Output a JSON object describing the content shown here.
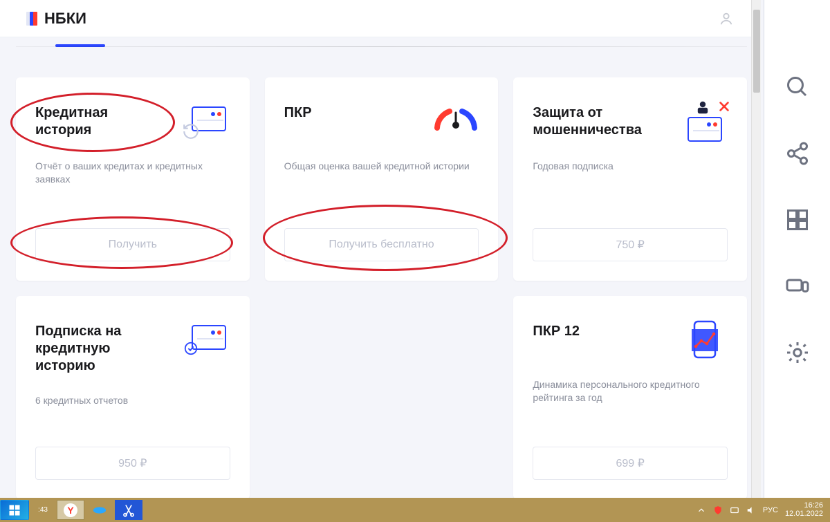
{
  "brand": "НБКИ",
  "cards": [
    {
      "title": "Кредитная история",
      "subtitle": "Отчёт о ваших кредитах и кредитных заявках",
      "button": "Получить"
    },
    {
      "title": "ПКР",
      "subtitle": "Общая оценка вашей кредитной истории",
      "button": "Получить бесплатно"
    },
    {
      "title": "Защита от мошенничества",
      "subtitle": "Годовая подписка",
      "button": "750 ₽"
    },
    {
      "title": "Подписка на кредитную историю",
      "subtitle": "6 кредитных отчетов",
      "button": "950 ₽"
    },
    {
      "title": "",
      "subtitle": "",
      "button": ""
    },
    {
      "title": "ПКР 12",
      "subtitle": "Динамика персонального кредитного рейтинга за год",
      "button": "699 ₽"
    }
  ],
  "taskbar": {
    "lang": "РУС",
    "time": "16:26",
    "date": "12.01.2022"
  }
}
